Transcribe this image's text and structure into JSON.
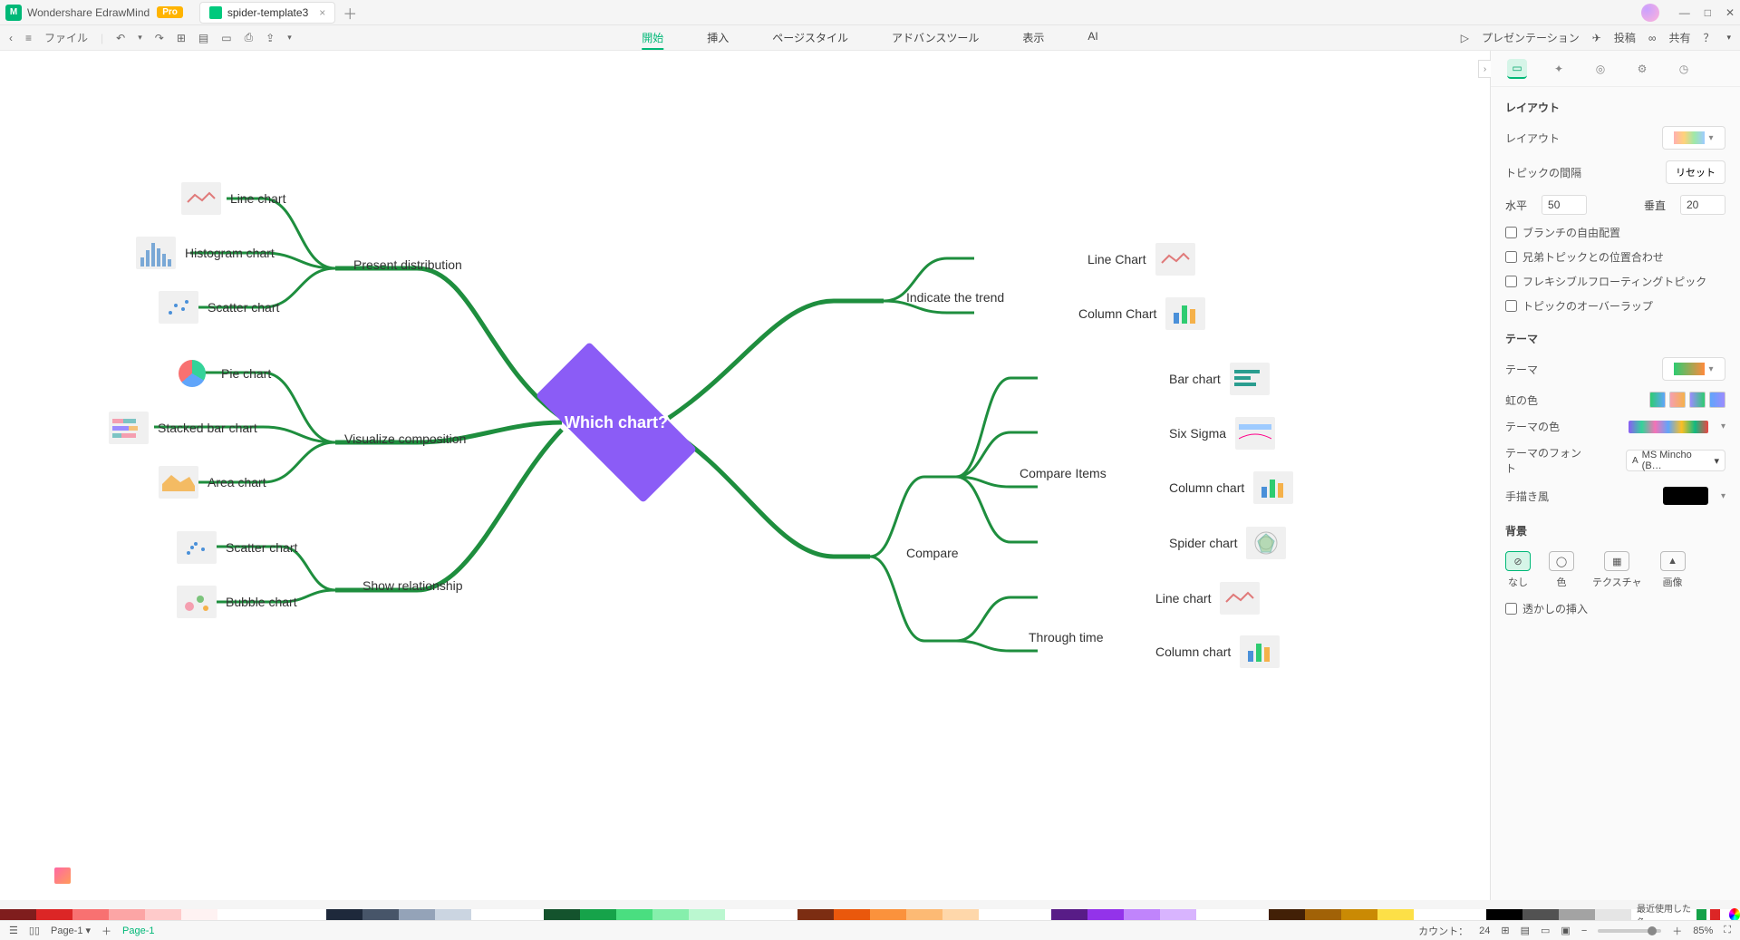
{
  "app": {
    "name": "Wondershare EdrawMind",
    "pro": "Pro",
    "doc_tab": "spider-template3"
  },
  "toolbar": {
    "file": "ファイル"
  },
  "menu": {
    "items": [
      "開始",
      "挿入",
      "ページスタイル",
      "アドバンスツール",
      "表示",
      "AI"
    ],
    "active": 0
  },
  "header_right": {
    "present": "プレゼンテーション",
    "post": "投稿",
    "share": "共有"
  },
  "mindmap": {
    "center": "Which chart?",
    "left": [
      {
        "label": "Present distribution",
        "leaves": [
          "Line chart",
          "Histogram chart",
          "Scatter chart"
        ]
      },
      {
        "label": "Visualize composition",
        "leaves": [
          "Pie chart",
          "Stacked bar chart",
          "Area chart"
        ]
      },
      {
        "label": "Show relationship",
        "leaves": [
          "Scatter chart",
          "Bubble chart"
        ]
      }
    ],
    "right": [
      {
        "label": "Indicate the trend",
        "leaves": [
          "Line Chart",
          "Column Chart"
        ]
      },
      {
        "label": "Compare",
        "children": [
          {
            "label": "Compare Items",
            "leaves": [
              "Bar chart",
              "Six Sigma",
              "Column chart",
              "Spider chart"
            ]
          },
          {
            "label": "Through time",
            "leaves": [
              "Line chart",
              "Column chart"
            ]
          }
        ]
      }
    ]
  },
  "rpanel": {
    "section_layout": "レイアウト",
    "layout": "レイアウト",
    "topic_gap": "トピックの間隔",
    "reset": "リセット",
    "horiz": "水平",
    "horiz_val": "50",
    "vert": "垂直",
    "vert_val": "20",
    "free_branch": "ブランチの自由配置",
    "sibling_align": "兄弟トピックとの位置合わせ",
    "flex_float": "フレキシブルフローティングトピック",
    "overlap": "トピックのオーバーラップ",
    "section_theme": "テーマ",
    "theme": "テーマ",
    "rainbow": "虹の色",
    "theme_color": "テーマの色",
    "theme_font": "テーマのフォント",
    "font_val": "MS Mincho (B…",
    "hand": "手描き風",
    "section_bg": "背景",
    "bg_none": "なし",
    "bg_color": "色",
    "bg_tex": "テクスチャ",
    "bg_img": "画像",
    "watermark": "透かしの挿入"
  },
  "status": {
    "count_label": "カウント：",
    "count": "24",
    "zoom": "85%",
    "page": "Page-1",
    "page2": "Page-1",
    "recent": "最近使用した色"
  }
}
